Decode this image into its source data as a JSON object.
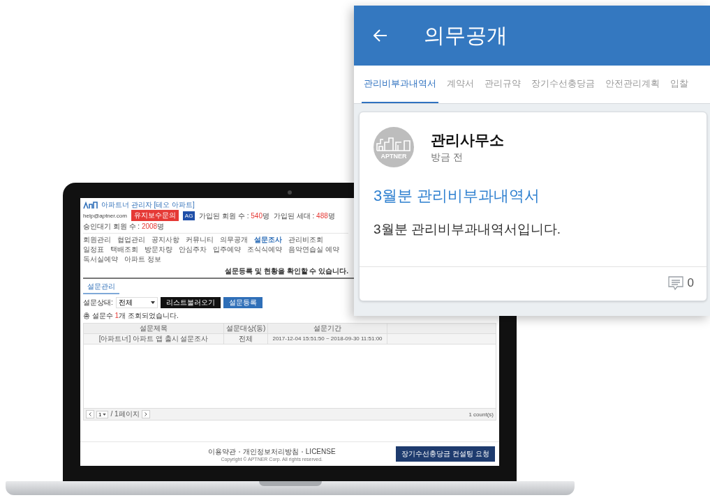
{
  "laptop_screen": {
    "header": {
      "title": "아파트너 관리자 [테오 아파트]",
      "email": "help@aptner.com",
      "inquiry_button": "유지보수문의",
      "badge": "AG",
      "stats": [
        {
          "label": "가입된 회원 수 : ",
          "value": "540",
          "unit": "명"
        },
        {
          "label": "가입된 세대 : ",
          "value": "488",
          "unit": "명"
        },
        {
          "label": "승인대기 회원 수 : ",
          "value": "2008",
          "unit": "명"
        }
      ]
    },
    "nav": [
      {
        "label": "회원관리",
        "selected": false
      },
      {
        "label": "협업관리",
        "selected": false
      },
      {
        "label": "공지사항",
        "selected": false
      },
      {
        "label": "커뮤니티",
        "selected": false
      },
      {
        "label": "의무공개",
        "selected": false
      },
      {
        "label": "설문조사",
        "selected": true
      },
      {
        "label": "관리비조회",
        "selected": false
      },
      {
        "label": "일정표",
        "selected": false
      },
      {
        "label": "택배조회",
        "selected": false
      },
      {
        "label": "방문차량",
        "selected": false
      },
      {
        "label": "안심주차",
        "selected": false
      },
      {
        "label": "입주예약",
        "selected": false
      },
      {
        "label": "조식식예약",
        "selected": false
      },
      {
        "label": "음악연습실 예약",
        "selected": false
      },
      {
        "label": "독서실예약",
        "selected": false
      },
      {
        "label": "아파트 정보",
        "selected": false
      }
    ],
    "page_description": "설문등록 및 현황을 확인할 수 있습니다.",
    "section_tab": {
      "label": "설문관리",
      "selected": true
    },
    "filter": {
      "label": "설문상태:",
      "value": "전체",
      "buttons": [
        {
          "label": "리스트불러오기",
          "kind": "dark"
        },
        {
          "label": "설문등록",
          "kind": "primary"
        }
      ]
    },
    "result_count": {
      "prefix": "총 설문수 ",
      "value": "1",
      "suffix": "개 조회되었습니다."
    },
    "table": {
      "columns": [
        "설문제목",
        "설문대상(동)",
        "설문기간"
      ],
      "rows": [
        {
          "cells": [
            "[아파트너] 아파트 앱 출시 설문조사",
            "전체",
            "2017-12-04 15:51:50 ~ 2018-09-30 11:51:00"
          ]
        }
      ]
    },
    "pagination": {
      "page": "1",
      "total": "/ 1페이지",
      "count": "1 count(s)"
    },
    "footer": {
      "links": [
        "이용약관",
        "개인정보처리방침",
        "LICENSE"
      ],
      "copyright": "Copyright © APTNER Corp. All rights reserved.",
      "consult_button": "장기수선충당금 컨설팅 요청"
    }
  },
  "mobile_screen": {
    "title": "의무공개",
    "tabs": [
      {
        "label": "관리비부과내역서",
        "selected": true
      },
      {
        "label": "계약서",
        "selected": false
      },
      {
        "label": "관리규약",
        "selected": false
      },
      {
        "label": "장기수선충당금",
        "selected": false
      },
      {
        "label": "안전관리계획",
        "selected": false
      },
      {
        "label": "입찰",
        "selected": false
      }
    ],
    "post": {
      "avatar_label": "APTNER",
      "author": "관리사무소",
      "time": "방금 전",
      "title": "3월분 관리비부과내역서",
      "body": "3월분 관리비부과내역서입니다.",
      "comment_count": "0"
    }
  }
}
